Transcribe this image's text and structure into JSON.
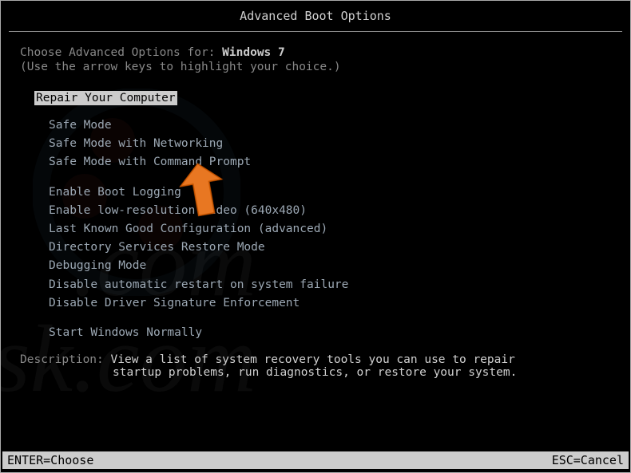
{
  "title": "Advanced Boot Options",
  "intro_prefix": "Choose Advanced Options for: ",
  "os_name": "Windows 7",
  "hint": "(Use the arrow keys to highlight your choice.)",
  "selected_item": "Repair Your Computer",
  "groups": {
    "g1": [
      "Safe Mode",
      "Safe Mode with Networking",
      "Safe Mode with Command Prompt"
    ],
    "g2": [
      "Enable Boot Logging",
      "Enable low-resolution video (640x480)",
      "Last Known Good Configuration (advanced)",
      "Directory Services Restore Mode",
      "Debugging Mode",
      "Disable automatic restart on system failure",
      "Disable Driver Signature Enforcement"
    ],
    "g3": [
      "Start Windows Normally"
    ]
  },
  "description": {
    "label": "Description: ",
    "line1": "View a list of system recovery tools you can use to repair",
    "line2": "startup problems, run diagnostics, or restore your system."
  },
  "footer": {
    "enter": "ENTER=Choose",
    "esc": "ESC=Cancel"
  }
}
